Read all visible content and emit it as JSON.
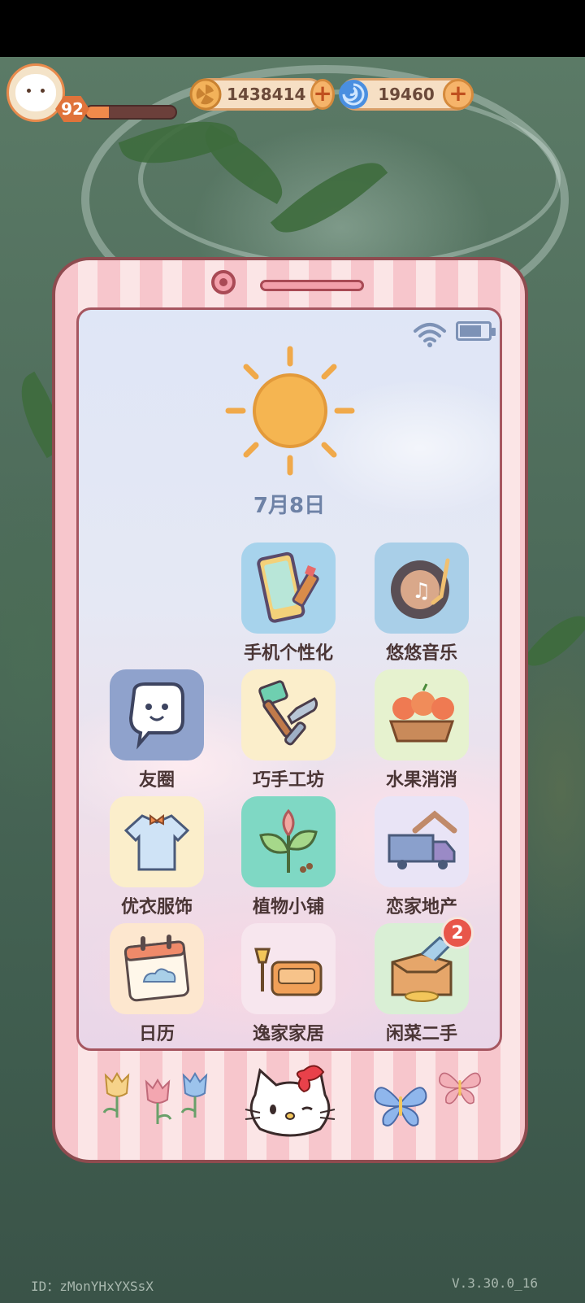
{
  "hud": {
    "level": "92",
    "xp_progress": 0.25,
    "coins": "1438414",
    "gems": "19460",
    "coin_icon": "fan-coin-icon",
    "gem_icon": "swirl-gem-icon",
    "plus_label": "+"
  },
  "phone": {
    "status": {
      "wifi_icon": "wifi-icon",
      "battery_icon": "battery-icon",
      "battery_level": 0.8
    },
    "weather_icon": "sun-icon",
    "date": "7月8日",
    "apps": [
      {
        "label": "手机个性化",
        "icon": "phone-paint-icon",
        "bg": "#a7d3ec"
      },
      {
        "label": "悠悠音乐",
        "icon": "record-player-icon",
        "bg": "#a9cfe8"
      },
      {
        "label": "友圈",
        "icon": "chat-bubble-icon",
        "bg": "#8fa2cc"
      },
      {
        "label": "巧手工坊",
        "icon": "tools-icon",
        "bg": "#fbeecb"
      },
      {
        "label": "水果消消",
        "icon": "fruit-basket-icon",
        "bg": "#e6f2cf"
      },
      {
        "label": "优衣服饰",
        "icon": "shirt-icon",
        "bg": "#fbeecb"
      },
      {
        "label": "植物小铺",
        "icon": "sprout-icon",
        "bg": "#7fd8c4"
      },
      {
        "label": "恋家地产",
        "icon": "moving-truck-icon",
        "bg": "#e9e4f6"
      },
      {
        "label": "日历",
        "icon": "calendar-icon",
        "bg": "#fde7cf"
      },
      {
        "label": "逸家家居",
        "icon": "sofa-lamp-icon",
        "bg": "#f7e6ee"
      },
      {
        "label": "闲菜二手",
        "icon": "box-tag-icon",
        "bg": "#d9efd5",
        "badge": "2"
      }
    ]
  },
  "footer": {
    "id": "ID：zMonYHxYXSsX",
    "version": "V.3.30.0_16"
  },
  "colors": {
    "phone_frame": "#8e4b4f",
    "stripe_pink": "#f7c6cc",
    "accent_orange": "#f08a4b",
    "badge_red": "#e8564a",
    "date_blue": "#6e82a6"
  }
}
